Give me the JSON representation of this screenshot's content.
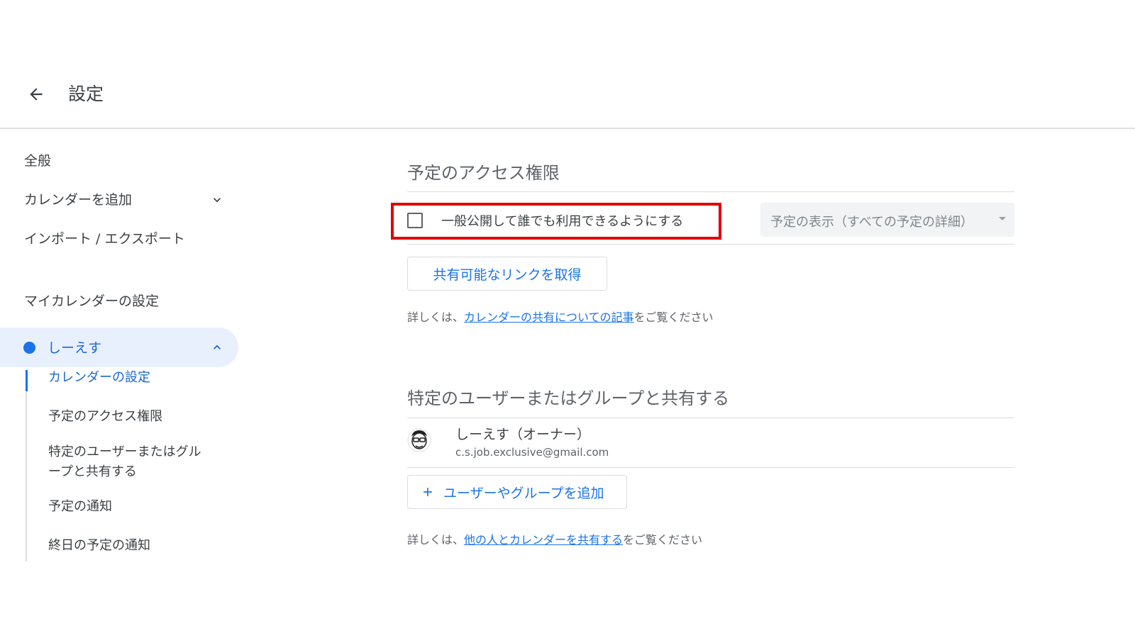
{
  "header": {
    "back_icon": "arrow-back-icon",
    "title": "設定"
  },
  "sidebar": {
    "items": [
      {
        "label": "全般"
      },
      {
        "label": "カレンダーを追加",
        "icon": "chevron-down-icon"
      },
      {
        "label": "インポート / エクスポート"
      }
    ],
    "my_calendars_heading": "マイカレンダーの設定",
    "active_calendar": {
      "name": "しーえす",
      "dot_color": "#1a73e8",
      "icon": "chevron-up-icon"
    },
    "sub_items": [
      {
        "label": "カレンダーの設定"
      },
      {
        "label": "予定のアクセス権限"
      },
      {
        "label": "特定のユーザーまたはグル"
      },
      {
        "label": "ープと共有する"
      },
      {
        "label": "予定の通知"
      },
      {
        "label": "終日の予定の通知"
      }
    ]
  },
  "access": {
    "title": "予定のアクセス権限",
    "public_checkbox_label": "一般公開して誰でも利用できるようにする",
    "public_checked": false,
    "visibility_select": "予定の表示（すべての予定の詳細）",
    "get_link_button": "共有可能なリンクを取得",
    "helper_prefix": "詳しくは、",
    "helper_link": "カレンダーの共有についての記事",
    "helper_suffix": "をご覧ください"
  },
  "share": {
    "title": "特定のユーザーまたはグループと共有する",
    "owner_name": "しーえす（オーナー）",
    "owner_email": "c.s.job.exclusive@gmail.com",
    "add_button": "ユーザーやグループを追加",
    "add_icon": "plus-icon",
    "helper_prefix": "詳しくは、",
    "helper_link": "他の人とカレンダーを共有する",
    "helper_suffix": "をご覧ください"
  },
  "colors": {
    "accent": "#1a73e8",
    "highlight_box": "#e00000",
    "active_bg": "#e8f0fe"
  }
}
